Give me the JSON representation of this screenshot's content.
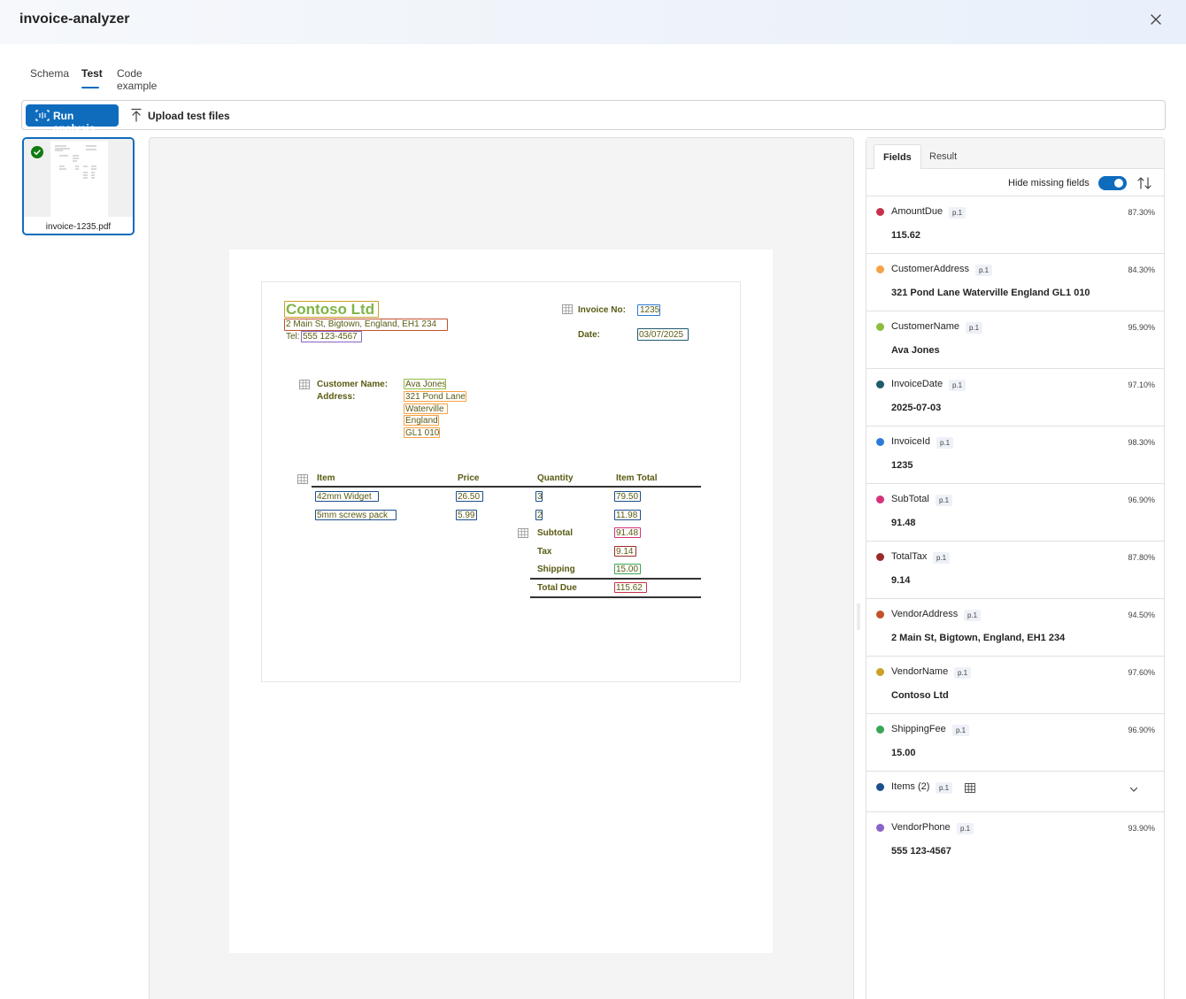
{
  "app": {
    "title": "invoice-analyzer"
  },
  "tabs": [
    {
      "label": "Schema"
    },
    {
      "label": "Test"
    },
    {
      "label": "Code example"
    }
  ],
  "active_tab": "Test",
  "toolbar": {
    "run_label": "Run analysis",
    "upload_label": "Upload test files"
  },
  "files": [
    {
      "name": "invoice-1235.pdf",
      "status": "analyzed"
    }
  ],
  "invoice": {
    "vendor_name": "Contoso Ltd",
    "vendor_address": "2 Main St, Bigtown, England, EH1 234",
    "tel_label": "Tel:",
    "vendor_phone": "555 123-4567",
    "invoice_no_label": "Invoice No:",
    "invoice_no": "1235",
    "date_label": "Date:",
    "date": "03/07/2025",
    "customer_name_label": "Customer Name:",
    "address_label": "Address:",
    "customer_name": "Ava Jones",
    "customer_address_lines": [
      "321 Pond Lane",
      "Waterville",
      "England",
      "GL1 010"
    ],
    "headers": [
      "Item",
      "Price",
      "Quantity",
      "Item Total"
    ],
    "items": [
      {
        "item": "42mm Widget",
        "price": "26.50",
        "qty": "3",
        "total": "79.50"
      },
      {
        "item": "5mm screws pack",
        "price": "5.99",
        "qty": "2",
        "total": "11.98"
      }
    ],
    "totals": [
      {
        "label": "Subtotal",
        "value": "91.48"
      },
      {
        "label": "Tax",
        "value": "9.14"
      },
      {
        "label": "Shipping",
        "value": "15.00"
      },
      {
        "label": "Total Due",
        "value": "115.62"
      }
    ]
  },
  "panel": {
    "tabs": [
      "Fields",
      "Result"
    ],
    "hide_missing_label": "Hide missing fields",
    "hide_missing_on": true,
    "fields": [
      {
        "name": "AmountDue",
        "page": "p.1",
        "confidence": "87.30%",
        "value": "115.62",
        "color": "#c4314b"
      },
      {
        "name": "CustomerAddress",
        "page": "p.1",
        "confidence": "84.30%",
        "value": "321 Pond Lane Waterville England GL1 010",
        "color": "#f7a145"
      },
      {
        "name": "CustomerName",
        "page": "p.1",
        "confidence": "95.90%",
        "value": "Ava Jones",
        "color": "#8cbd3f"
      },
      {
        "name": "InvoiceDate",
        "page": "p.1",
        "confidence": "97.10%",
        "value": "2025-07-03",
        "color": "#1e5b6b"
      },
      {
        "name": "InvoiceId",
        "page": "p.1",
        "confidence": "98.30%",
        "value": "1235",
        "color": "#2b7bd6"
      },
      {
        "name": "SubTotal",
        "page": "p.1",
        "confidence": "96.90%",
        "value": "91.48",
        "color": "#d6317e"
      },
      {
        "name": "TotalTax",
        "page": "p.1",
        "confidence": "87.80%",
        "value": "9.14",
        "color": "#9c2a2a"
      },
      {
        "name": "VendorAddress",
        "page": "p.1",
        "confidence": "94.50%",
        "value": "2 Main St, Bigtown, England, EH1 234",
        "color": "#c4512a"
      },
      {
        "name": "VendorName",
        "page": "p.1",
        "confidence": "97.60%",
        "value": "Contoso Ltd",
        "color": "#c9a227"
      },
      {
        "name": "ShippingFee",
        "page": "p.1",
        "confidence": "96.90%",
        "value": "15.00",
        "color": "#3aa657"
      },
      {
        "name": "Items (2)",
        "page": "p.1",
        "confidence": "",
        "value": "",
        "color": "#1c4f8c",
        "kind": "table"
      },
      {
        "name": "VendorPhone",
        "page": "p.1",
        "confidence": "93.90%",
        "value": "555 123-4567",
        "color": "#8a63c7"
      }
    ]
  },
  "colors": {
    "accent": "#0f6cbd",
    "success": "#107c10",
    "vendor_name_box": "#c9a227",
    "vendor_address_box": "#c4512a",
    "vendor_phone_box": "#8a63c7",
    "invoice_id_box": "#2b7bd6",
    "invoice_date_box": "#1e5b6b",
    "customer_name_box": "#8cbd3f",
    "customer_address_box": "#f7a145",
    "items_box": "#1c4f8c",
    "subtotal_box": "#d6317e",
    "tax_box": "#9c2a2a",
    "shipping_box": "#3aa657",
    "amount_due_box": "#c4314b"
  },
  "icons": {
    "close": "close-icon",
    "run": "analyze-icon",
    "upload": "upload-icon",
    "check": "checkmark-icon",
    "table": "table-icon",
    "sort": "sort-icon",
    "chevron": "chevron-down-icon"
  }
}
